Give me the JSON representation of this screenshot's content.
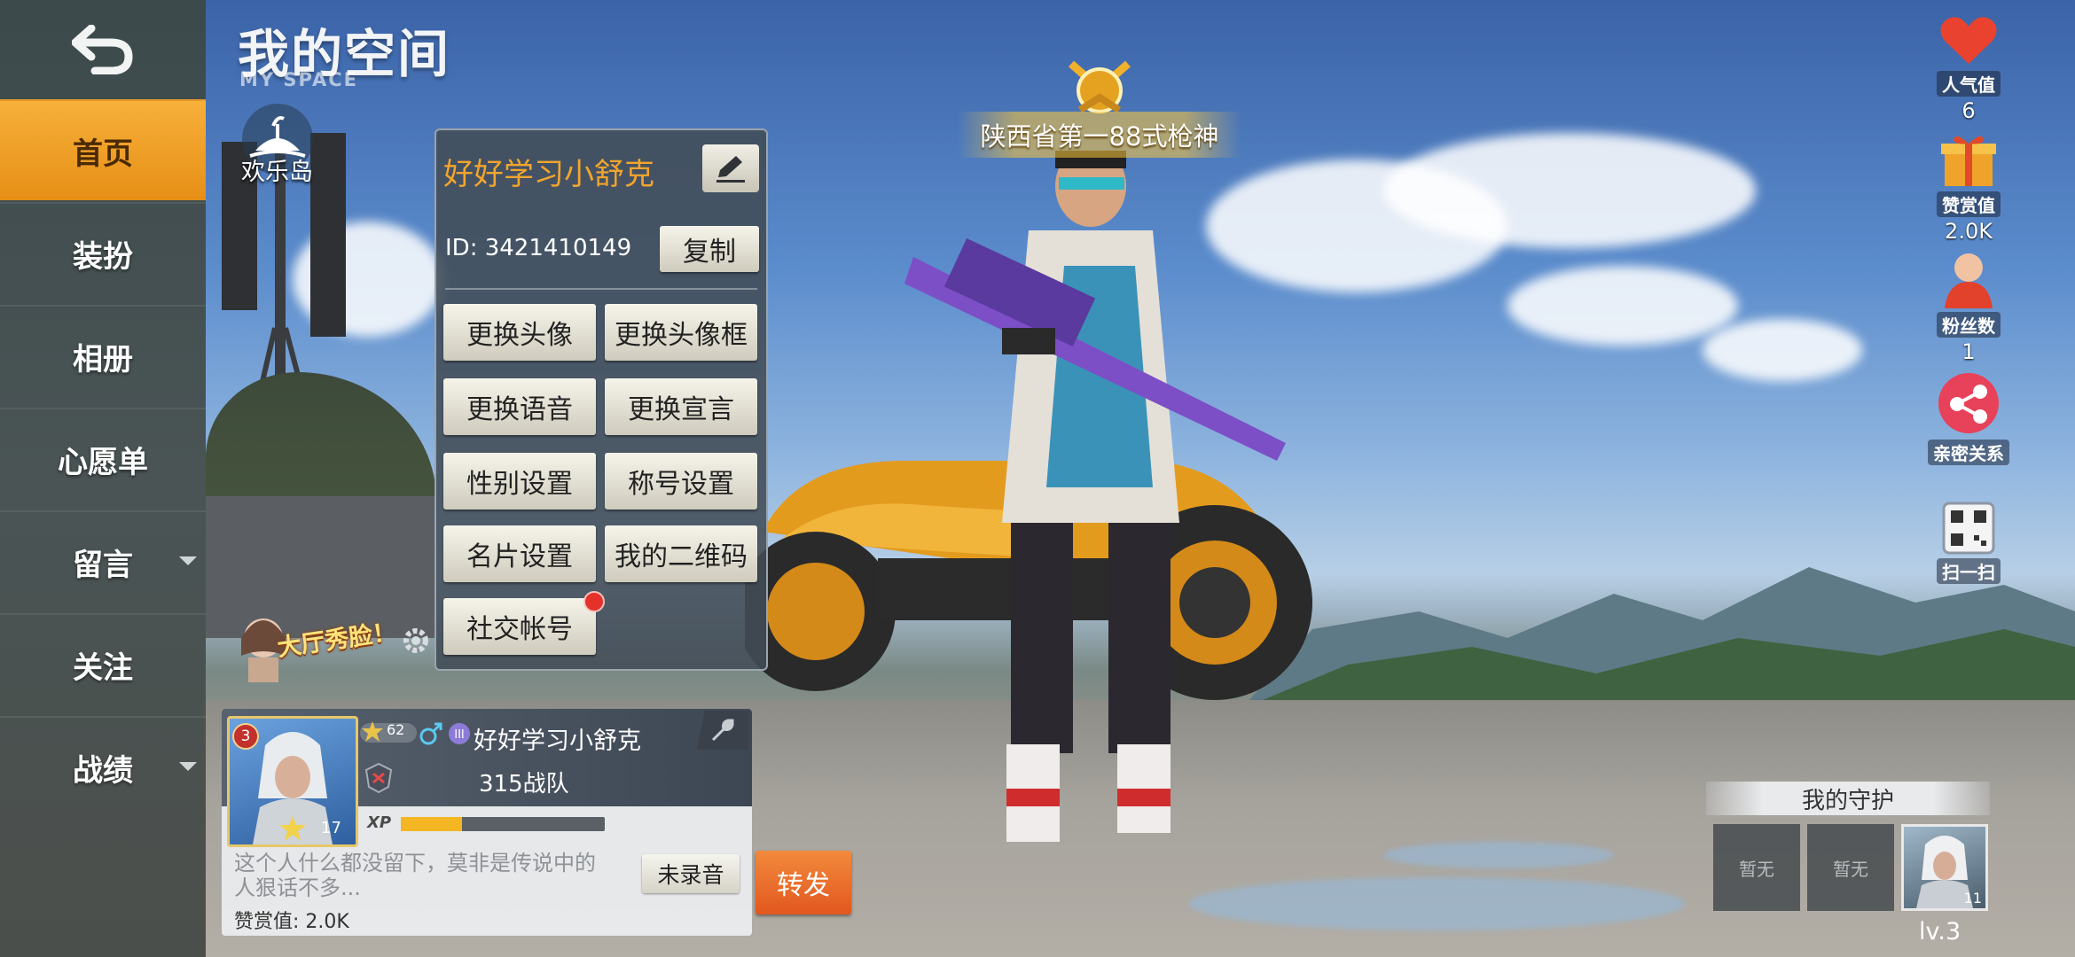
{
  "page": {
    "title": "我的空间",
    "subtitle": "MY SPACE",
    "island": "欢乐岛",
    "hall_show": "大厅秀脸！"
  },
  "nav": {
    "items": [
      {
        "label": "首页",
        "active": true,
        "caret": false
      },
      {
        "label": "装扮",
        "active": false,
        "caret": false
      },
      {
        "label": "相册",
        "active": false,
        "caret": false
      },
      {
        "label": "心愿单",
        "active": false,
        "caret": false
      },
      {
        "label": "留言",
        "active": false,
        "caret": true
      },
      {
        "label": "关注",
        "active": false,
        "caret": false
      },
      {
        "label": "战绩",
        "active": false,
        "caret": true
      }
    ]
  },
  "profile_menu": {
    "name": "好好学习小舒克",
    "id_text": "ID: 3421410149",
    "copy": "复制",
    "buttons": [
      "更换头像",
      "更换头像框",
      "更换语音",
      "更换宣言",
      "性别设置",
      "称号设置",
      "名片设置",
      "我的二维码",
      "社交帐号"
    ]
  },
  "card": {
    "rank": "3",
    "level_badge": "62",
    "name": "好好学习小舒克",
    "team": "315战队",
    "avatar_level": "17",
    "xp_label": "XP",
    "xp_progress": 0.3,
    "desc": "这个人什么都没留下，莫非是传说中的人狠话不多...",
    "voice_button": "未录音",
    "appreciation": "赞赏值: 2.0K"
  },
  "forward_button": "转发",
  "character_title": "陕西省第一88式枪神",
  "stats": [
    {
      "label": "人气值",
      "value": "6",
      "icon": "heart-icon"
    },
    {
      "label": "赞赏值",
      "value": "2.0K",
      "icon": "gift-icon"
    },
    {
      "label": "粉丝数",
      "value": "1",
      "icon": "fan-icon"
    },
    {
      "label": "亲密关系",
      "value": "",
      "icon": "share-icon"
    },
    {
      "label": "扫一扫",
      "value": "",
      "icon": "qr-icon"
    }
  ],
  "guardians": {
    "title": "我的守护",
    "slots": [
      "暂无",
      "暂无"
    ],
    "avatar_level": "11",
    "level": "lv.3"
  },
  "colors": {
    "accent_orange": "#f3a52c",
    "nav_active": "#f0a02a",
    "forward": "#e8652a"
  }
}
